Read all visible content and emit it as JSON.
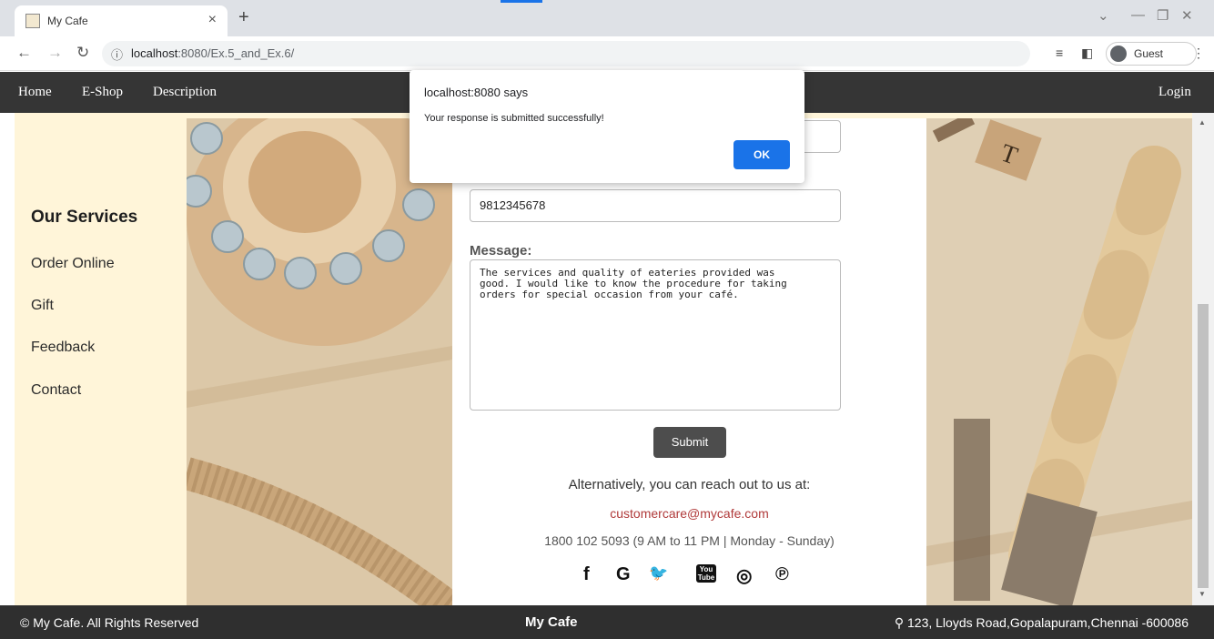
{
  "browser": {
    "tab_title": "My Cafe",
    "tab_close": "×",
    "new_tab": "+",
    "url_host": "localhost",
    "url_path": ":8080/Ex.5_and_Ex.6/",
    "guest_label": "Guest",
    "accent_color": "#1a73e8"
  },
  "site_nav": {
    "home": "Home",
    "eshop": "E-Shop",
    "description": "Description",
    "login": "Login"
  },
  "sidebar": {
    "heading": "Our Services",
    "items": [
      "Order Online",
      "Gift",
      "Feedback",
      "Contact"
    ]
  },
  "form": {
    "mobile_label": "Mobile:",
    "mobile_value": "9812345678",
    "message_label": "Message:",
    "message_value": "The services and quality of eateries provided was\ngood. I would like to know the procedure for taking\norders for special occasion from your café.",
    "submit_label": "Submit"
  },
  "contact": {
    "alt_text": "Alternatively, you can reach out to us at:",
    "email": "customercare@mycafe.com",
    "phone": "1800 102 5093 (9 AM to 11 PM | Monday - Sunday)"
  },
  "social": {
    "facebook": "f",
    "google": "G",
    "twitter": "🐦",
    "youtube": "You Tube",
    "instagram": "◎",
    "pinterest": "℗"
  },
  "footer": {
    "copyright": "© My Cafe. All Rights Reserved",
    "brand": "My Cafe",
    "address": "123, Lloyds Road,Gopalapuram,Chennai -600086"
  },
  "dialog": {
    "origin": "localhost:8080 says",
    "message": "Your response is submitted successfully!",
    "ok_label": "OK"
  },
  "colors": {
    "nav_bg": "#353535",
    "page_bg": "#fff5d9",
    "footer_bg": "#2f2f2f",
    "email_color": "#b03a3a"
  }
}
